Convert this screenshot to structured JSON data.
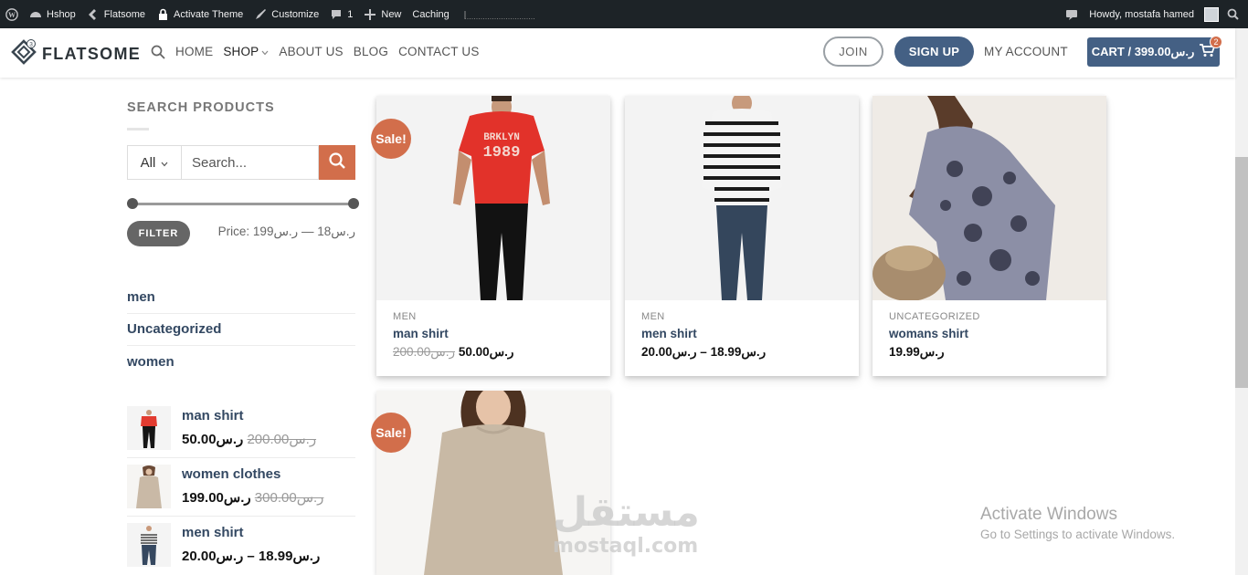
{
  "adminbar": {
    "site_name": "Hshop",
    "theme_name": "Flatsome",
    "activate_theme": "Activate Theme",
    "customize": "Customize",
    "comments_count": "1",
    "new": "New",
    "caching": "Caching",
    "howdy": "Howdy, mostafa hamed"
  },
  "header": {
    "logo_text": "FLATSOME",
    "nav": [
      "HOME",
      "SHOP",
      "ABOUT US",
      "BLOG",
      "CONTACT US"
    ],
    "join": "JOIN",
    "signup": "SIGN UP",
    "my_account": "MY ACCOUNT",
    "cart_label": "CART / ر.س399.00",
    "cart_count": "2",
    "accent": "#446084"
  },
  "sidebar": {
    "search_title": "SEARCH PRODUCTS",
    "category_select": "All",
    "search_placeholder": "Search...",
    "filter_button": "FILTER",
    "price_range": "Price: ر.س18 — ر.س199",
    "categories": [
      "men",
      "Uncategorized",
      "women"
    ],
    "mini_products": [
      {
        "name": "man shirt",
        "price_old": "ر.س200.00",
        "price": "ر.س50.00"
      },
      {
        "name": "women clothes",
        "price_old": "ر.س300.00",
        "price": "ر.س199.00"
      },
      {
        "name": "men shirt",
        "price_old": "",
        "price": "ر.س18.99 – ر.س20.00"
      }
    ]
  },
  "products": [
    {
      "category": "MEN",
      "name": "man shirt",
      "price_old": "ر.س200.00",
      "price": "ر.س50.00",
      "sale": "Sale!"
    },
    {
      "category": "MEN",
      "name": "men shirt",
      "price_old": "",
      "price": "ر.س18.99 – ر.س20.00",
      "sale": ""
    },
    {
      "category": "UNCATEGORIZED",
      "name": "womans shirt",
      "price_old": "",
      "price": "ر.س19.99",
      "sale": ""
    },
    {
      "category": "",
      "name": "",
      "price_old": "",
      "price": "",
      "sale": "Sale!"
    }
  ],
  "overlays": {
    "watermark_ar": "مستقل",
    "watermark_en": "mostaql.com",
    "activate_title": "Activate Windows",
    "activate_sub": "Go to Settings to activate Windows."
  },
  "colors": {
    "sale_badge": "#d26e4b",
    "button_blue": "#446084",
    "search_button": "#d26e4b"
  }
}
